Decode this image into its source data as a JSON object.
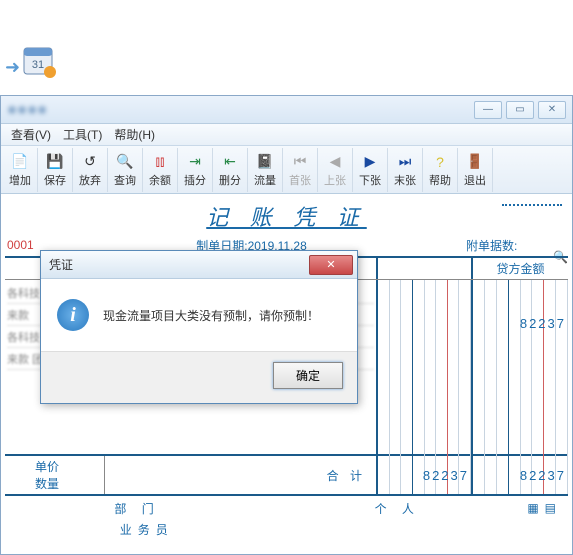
{
  "calendar_day": "31",
  "titlebar_text": "※※※※",
  "menus": {
    "view": "查看(V)",
    "tools": "工具(T)",
    "help": "帮助(H)"
  },
  "toolbar": {
    "add": "增加",
    "save": "保存",
    "discard": "放弃",
    "query": "查询",
    "balance": "余额",
    "split_ins": "插分",
    "split_del": "删分",
    "flow": "流量",
    "first": "首张",
    "prev": "上张",
    "next": "下张",
    "last": "末张",
    "help": "帮助",
    "exit": "退出"
  },
  "doc": {
    "title": "记 账 凭 证",
    "seq": "0001",
    "date_label": "制单日期:",
    "date_value": "2019.11.28",
    "attach_label": "附单据数:"
  },
  "grid": {
    "credit_header": "贷方金额",
    "left_rows": [
      "各科技 1",
      "来款",
      "各科技",
      "来款 团"
    ],
    "credit_value": "82237"
  },
  "summary": {
    "unit_price": "单价",
    "quantity": "数量",
    "total_label": "合 计",
    "debit_total": "82237",
    "credit_total": "82237"
  },
  "footer": {
    "dept": "部 门",
    "biz": "业务员",
    "person": "个 人"
  },
  "dialog": {
    "title": "凭证",
    "message": "现金流量项目大类没有预制，请你预制！",
    "ok": "确定"
  }
}
